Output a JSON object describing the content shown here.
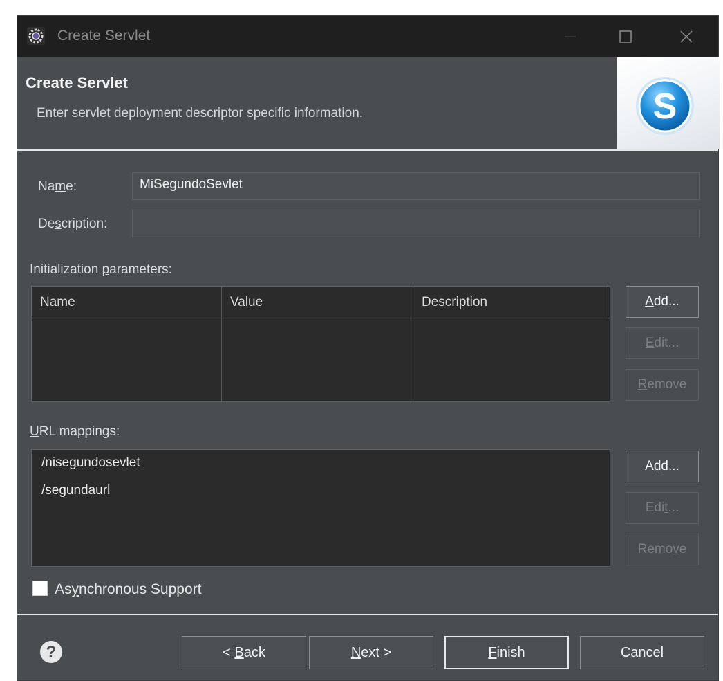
{
  "window": {
    "title": "Create Servlet"
  },
  "banner": {
    "title": "Create Servlet",
    "description": "Enter servlet deployment descriptor specific information.",
    "logo_letter": "S"
  },
  "form": {
    "name": {
      "label_pre": "Na",
      "label_u": "m",
      "label_post": "e:",
      "value": "MiSegundoSevlet"
    },
    "description": {
      "label_pre": "De",
      "label_u": "s",
      "label_post": "cription:",
      "value": ""
    }
  },
  "init_params": {
    "label_pre": "Initialization ",
    "label_u": "p",
    "label_post": "arameters:",
    "columns": [
      "Name",
      "Value",
      "Description"
    ],
    "rows": [],
    "buttons": {
      "add": {
        "u": "A",
        "rest": "dd..."
      },
      "edit": {
        "u": "E",
        "rest": "dit..."
      },
      "remove": {
        "u": "R",
        "rest": "emove"
      }
    }
  },
  "url_mappings": {
    "label_u": "U",
    "label_post": "RL mappings:",
    "items": [
      "/nisegundosevlet",
      "/segundaurl"
    ],
    "buttons": {
      "add": {
        "pre": "A",
        "u": "d",
        "rest": "d..."
      },
      "edit": {
        "pre": "Edi",
        "u": "t",
        "rest": "..."
      },
      "remove": {
        "pre": "Remo",
        "u": "v",
        "rest": "e"
      }
    }
  },
  "async": {
    "label_pre": "As",
    "label_u": "y",
    "label_post": "nchronous Support",
    "checked": false
  },
  "footer": {
    "back": {
      "pre": "< ",
      "u": "B",
      "rest": "ack"
    },
    "next": {
      "u": "N",
      "rest": "ext >"
    },
    "finish": {
      "u": "F",
      "rest": "inish"
    },
    "cancel": "Cancel"
  },
  "icons": {
    "app": "eclipse-gear-icon",
    "minimize": "minimize-icon",
    "maximize": "maximize-icon",
    "close": "close-icon",
    "help": "help-icon",
    "logo": "servlet-logo-icon"
  },
  "colors": {
    "dialog_bg": "#4a4d4f",
    "titlebar_bg": "#1f1f1f",
    "table_bg": "#2b2b2b",
    "logo_blue": "#1e8fdc"
  }
}
